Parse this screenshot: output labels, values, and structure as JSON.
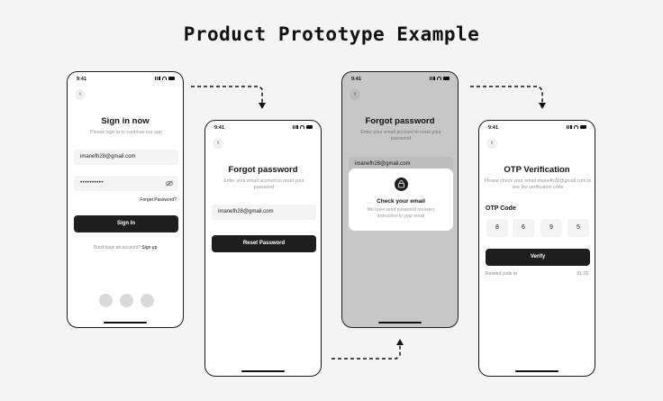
{
  "page": {
    "title": "Product Prototype Example"
  },
  "status": {
    "time": "9:41"
  },
  "signin": {
    "title": "Sign in now",
    "subtitle": "Please sign in to continue our app",
    "email": "imanefh28@gmail.com",
    "password": "••••••••••",
    "forgot_link": "Forget Password?",
    "button": "Sign In",
    "signup_prompt": "Don't have an account?",
    "signup_link": "Sign up"
  },
  "forgot": {
    "title": "Forgot password",
    "subtitle": "Enter your email account to reset your password",
    "email": "imanefh28@gmail.com",
    "button": "Reset Password"
  },
  "check": {
    "title": "Forgot password",
    "subtitle": "Enter your email account to reset your password",
    "email": "imanefh28@gmail.com",
    "modal_title": "Check your email",
    "modal_text": "We have send password recovery instruction to your email"
  },
  "otp": {
    "title": "OTP Verification",
    "subtitle": "Please check your email imanefh28@gmail.com to see the verification code",
    "label": "OTP Code",
    "digits": [
      "8",
      "6",
      "9",
      "5"
    ],
    "button": "Verify",
    "resend": "Resend code to",
    "timer": "01:26"
  },
  "colors": {
    "background": "#f4f4f4",
    "button": "#1e1e1e",
    "field": "#f3f3f3"
  }
}
